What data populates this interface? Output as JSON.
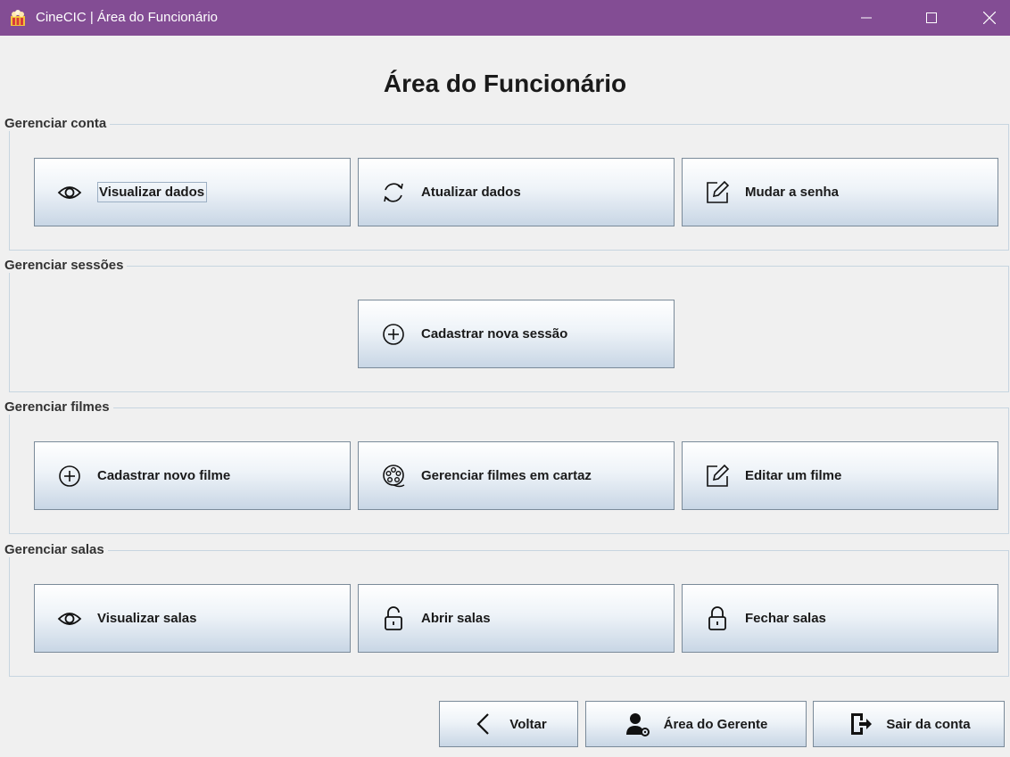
{
  "window": {
    "title": "CineCIC | Área do Funcionário",
    "accent": "#834d94"
  },
  "page": {
    "title": "Área do Funcionário"
  },
  "groups": [
    {
      "title": "Gerenciar conta",
      "buttons": [
        {
          "label": "Visualizar dados",
          "icon": "eye-icon"
        },
        {
          "label": "Atualizar dados",
          "icon": "refresh-icon"
        },
        {
          "label": "Mudar a senha",
          "icon": "edit-icon"
        }
      ]
    },
    {
      "title": "Gerenciar sessões",
      "buttons": [
        {
          "label": "Cadastrar nova sessão",
          "icon": "plus-circle-icon"
        }
      ]
    },
    {
      "title": "Gerenciar filmes",
      "buttons": [
        {
          "label": "Cadastrar novo filme",
          "icon": "plus-circle-icon"
        },
        {
          "label": "Gerenciar filmes em cartaz",
          "icon": "film-reel-icon"
        },
        {
          "label": "Editar um filme",
          "icon": "edit-icon"
        }
      ]
    },
    {
      "title": "Gerenciar salas",
      "buttons": [
        {
          "label": "Visualizar salas",
          "icon": "eye-icon"
        },
        {
          "label": "Abrir salas",
          "icon": "lock-open-icon"
        },
        {
          "label": "Fechar salas",
          "icon": "lock-icon"
        }
      ]
    }
  ],
  "footer": {
    "back_label": "Voltar",
    "manager_label": "Área do Gerente",
    "logout_label": "Sair da conta"
  }
}
